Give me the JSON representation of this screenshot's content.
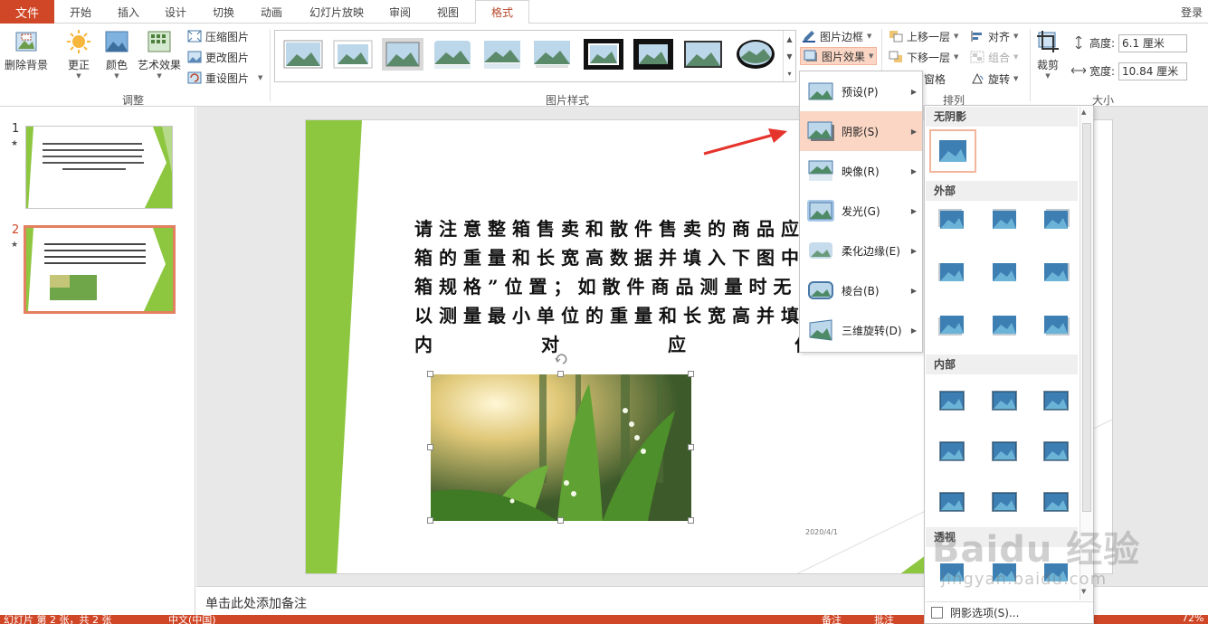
{
  "tabs": {
    "file": "文件",
    "items": [
      "开始",
      "插入",
      "设计",
      "切换",
      "动画",
      "幻灯片放映",
      "审阅",
      "视图",
      "格式"
    ],
    "active": "格式",
    "login": "登录"
  },
  "ribbon": {
    "adjust": {
      "remove_bg": "删除背景",
      "corrections": "更正",
      "color": "颜色",
      "artistic": "艺术效果",
      "compress": "压缩图片",
      "change": "更改图片",
      "reset": "重设图片",
      "group": "调整"
    },
    "styles_group": "图片样式",
    "picture_border": "图片边框",
    "picture_effects": "图片效果",
    "arrange": {
      "bring_forward": "上移一层",
      "send_backward": "下移一层",
      "align": "对齐",
      "group": "组合",
      "rotate": "旋转",
      "pane": "窗格",
      "group_label": "排列"
    },
    "size": {
      "crop": "裁剪",
      "height_label": "高度:",
      "height_value": "6.1 厘米",
      "width_label": "宽度:",
      "width_value": "10.84 厘米",
      "group": "大小"
    }
  },
  "slides": {
    "numbers": [
      "1",
      "2"
    ]
  },
  "slide": {
    "lines": [
      "请注意整箱售卖和散件售卖的商品应",
      "箱的重量和长宽高数据并填入下图中",
      "箱规格”位置；如散件商品测量时无",
      "以测量最小单位的重量和长宽高并填"
    ],
    "last_line": [
      "内",
      "对",
      "应",
      "位"
    ],
    "date": "2020/4/1"
  },
  "notes": "单击此处添加备注",
  "status": {
    "slide_info": "幻灯片 第 2 张，共 2 张",
    "language": "中文(中国)",
    "notes_btn": "备注",
    "comments_btn": "批注",
    "zoom": "72%"
  },
  "effects_menu": [
    {
      "label": "预设(P)"
    },
    {
      "label": "阴影(S)"
    },
    {
      "label": "映像(R)"
    },
    {
      "label": "发光(G)"
    },
    {
      "label": "柔化边缘(E)"
    },
    {
      "label": "棱台(B)"
    },
    {
      "label": "三维旋转(D)"
    }
  ],
  "shadow_menu": {
    "no_shadow": "无阴影",
    "outer": "外部",
    "inner": "内部",
    "perspective": "透视",
    "options": "阴影选项(S)..."
  },
  "watermark": "Baidu 经验",
  "watermark_sub": "jingyan.baidu.com",
  "colors": {
    "accent": "#d04727",
    "selected_menu": "#fbd6c4",
    "slide_green": "#8dc63f"
  }
}
